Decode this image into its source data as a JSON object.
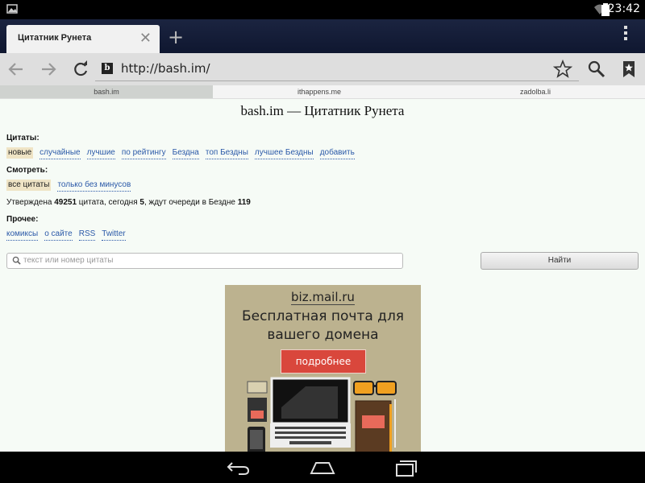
{
  "status": {
    "time": "23:42"
  },
  "browser": {
    "tab_title": "Цитатник Рунета",
    "url": "http://bash.im/",
    "favicon_letter": "b"
  },
  "site": {
    "tabs": [
      "bash.im",
      "ithappens.me",
      "zadolba.li"
    ],
    "heading": "bash.im — Цитатник Рунета",
    "quotes_label": "Цитаты:",
    "quotes_links": [
      "новые",
      "случайные",
      "лучшие",
      "по рейтингу",
      "Бездна",
      "топ Бездны",
      "лучшее Бездны",
      "добавить"
    ],
    "view_label": "Смотреть:",
    "view_links": [
      "все цитаты",
      "только без минусов"
    ],
    "stats": {
      "p1": "Утверждена ",
      "approved": "49251",
      "p2": " цитата, сегодня ",
      "today": "5",
      "p3": ", ждут очереди в Бездне ",
      "queue": "119"
    },
    "other_label": "Прочее:",
    "other_links": [
      "комиксы",
      "о сайте",
      "RSS",
      "Twitter"
    ],
    "search_placeholder": "текст или номер цитаты",
    "find_button": "Найти"
  },
  "ad": {
    "brand": "biz.mail.ru",
    "tagline_1": "Бесплатная почта для",
    "tagline_2": "вашего домена",
    "button": "подробнее"
  }
}
